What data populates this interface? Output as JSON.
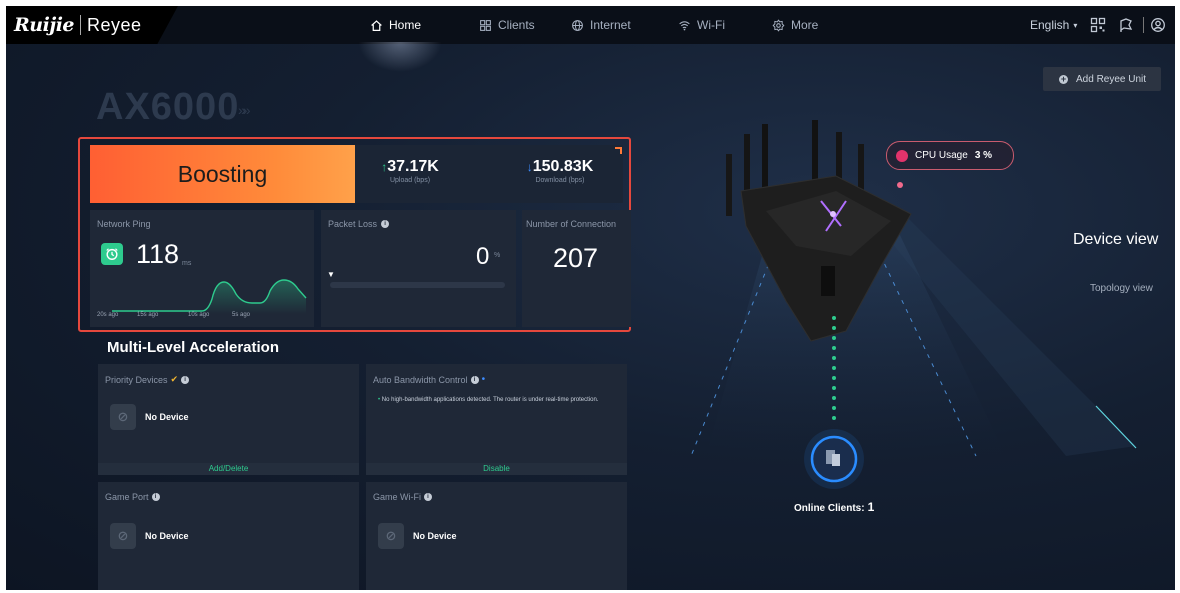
{
  "brand": {
    "name1": "Ruijie",
    "name2": "Reyee"
  },
  "nav": {
    "items": [
      {
        "label": "Home",
        "icon": "home-icon",
        "active": true
      },
      {
        "label": "Clients",
        "icon": "grid-icon",
        "active": false
      },
      {
        "label": "Internet",
        "icon": "globe-icon",
        "active": false
      },
      {
        "label": "Wi-Fi",
        "icon": "wifi-icon",
        "active": false
      },
      {
        "label": "More",
        "icon": "gear-icon",
        "active": false
      }
    ],
    "language": "English",
    "language_caret": "▾"
  },
  "device": {
    "model": "AX6000",
    "model_suffix": "»»"
  },
  "boost": {
    "label": "Boosting",
    "upload_value": "37.17K",
    "upload_label": "Upload (bps)",
    "upload_arrow": "↑",
    "download_value": "150.83K",
    "download_label": "Download (bps)",
    "download_arrow": "↓"
  },
  "ping": {
    "title": "Network Ping",
    "value": "118",
    "unit": "ms",
    "ticks": [
      "20s ago",
      "15s ago",
      "10s ago",
      "5s ago"
    ]
  },
  "packet_loss": {
    "title": "Packet Loss",
    "value": "0",
    "unit": "%",
    "caret": "▼"
  },
  "connections": {
    "title": "Number of Connection",
    "value": "207"
  },
  "acceleration": {
    "title": "Multi-Level Acceleration",
    "priority_devices": {
      "title": "Priority Devices",
      "tag": "✔",
      "status": "No Device",
      "action": "Add/Delete"
    },
    "auto_bandwidth": {
      "title": "Auto Bandwidth Control",
      "note": "No high-bandwidth applications detected. The router is under real-time protection.",
      "bullet": "•",
      "action": "Disable"
    },
    "game_port": {
      "title": "Game Port",
      "status": "No Device"
    },
    "game_wifi": {
      "title": "Game Wi-Fi",
      "status": "No Device"
    }
  },
  "right_panel": {
    "add_unit": "Add Reyee Unit",
    "cpu_label": "CPU Usage",
    "cpu_value": "3 %",
    "device_view": "Device view",
    "topology_view": "Topology view",
    "online_label": "Online Clients:",
    "online_value": "1"
  },
  "colors": {
    "accent_green": "#2ecb8e",
    "boost_orange": "#ff6a33",
    "highlight_red": "#e5483d",
    "cpu_pink": "#e3336b"
  }
}
